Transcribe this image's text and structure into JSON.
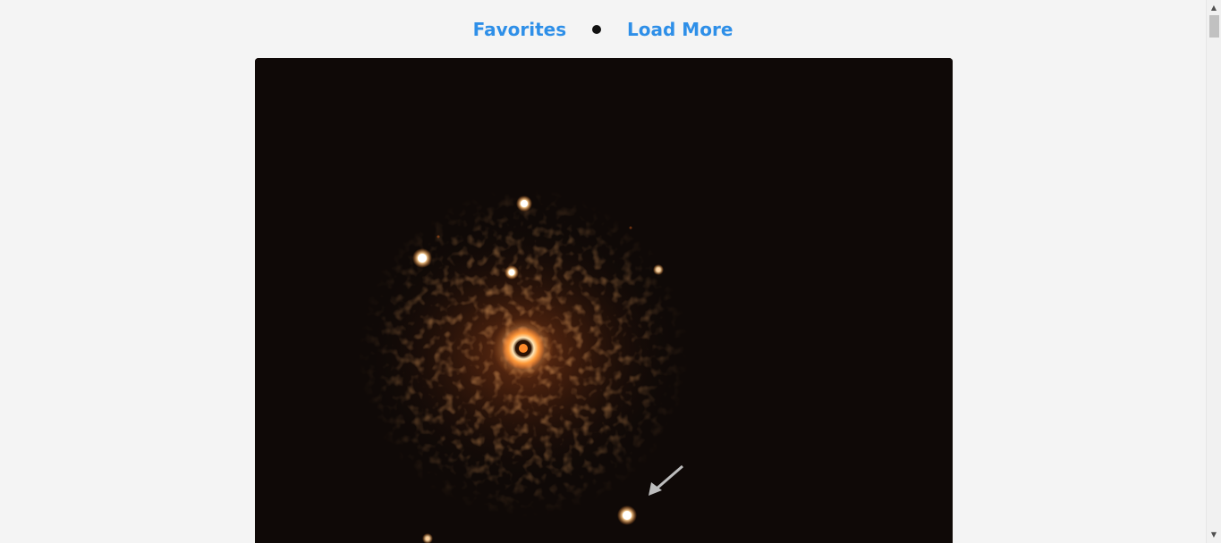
{
  "nav": {
    "favorites_label": "Favorites",
    "load_more_label": "Load More",
    "link_color": "#2e8fe8"
  },
  "photo": {
    "subject": "star with exoplanets image",
    "background_color": "#0f0907"
  },
  "scrollbar": {
    "up_arrow_icon": "triangle-up-icon",
    "down_arrow_icon": "triangle-down-icon",
    "up_glyph": "▲",
    "down_glyph": "▼"
  }
}
